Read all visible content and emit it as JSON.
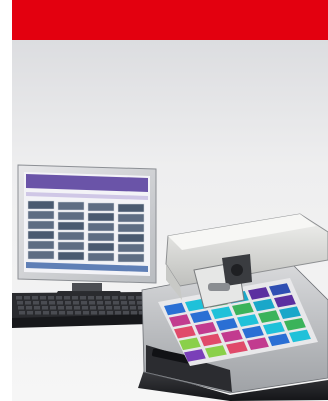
{
  "header": {
    "banner_color": "#e3000f"
  },
  "photo": {
    "subject": "product-photo-color-measurement-system",
    "monitor_swatch_grid": {
      "columns": 4,
      "rows": 6
    },
    "tray_swatch_grid": {
      "columns": 6,
      "rows": 5
    }
  }
}
